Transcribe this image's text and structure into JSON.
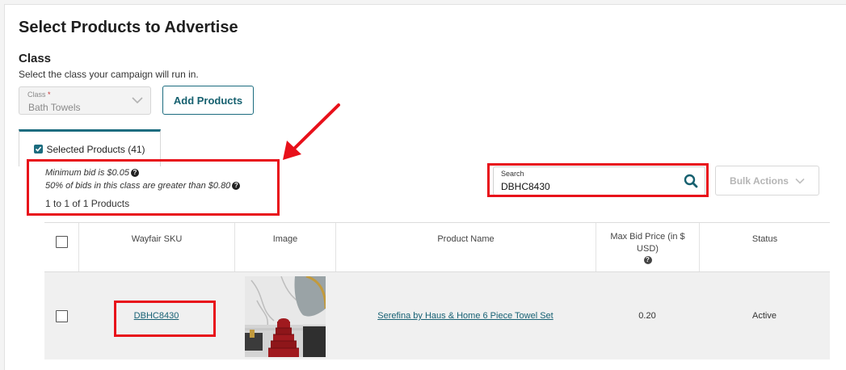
{
  "page": {
    "title": "Select Products to Advertise"
  },
  "class_section": {
    "heading": "Class",
    "description": "Select the class your campaign will run in.",
    "select_label": "Class",
    "select_required_mark": "*",
    "select_value": "Bath Towels",
    "add_products_label": "Add Products"
  },
  "tabs": [
    {
      "label": "Selected Products (41)",
      "checked": true
    }
  ],
  "info": {
    "min_bid": "Minimum bid is $0.05",
    "bids_note": "50% of bids in this class are greater than $0.80",
    "count": "1 to 1 of 1 Products"
  },
  "search": {
    "label": "Search",
    "value": "DBHC8430"
  },
  "bulk_actions": {
    "label": "Bulk Actions"
  },
  "table": {
    "headers": {
      "sku": "Wayfair SKU",
      "image": "Image",
      "product_name": "Product Name",
      "max_bid": "Max Bid Price (in $ USD)",
      "status": "Status"
    },
    "rows": [
      {
        "sku": "DBHC8430",
        "image_alt": "red towel set",
        "product_name": "Serefina by Haus & Home 6 Piece Towel Set",
        "max_bid": "0.20",
        "status": "Active"
      }
    ]
  },
  "colors": {
    "accent": "#1c6c7f",
    "highlight": "#e8101a",
    "towel_red": "#a01a1f"
  }
}
